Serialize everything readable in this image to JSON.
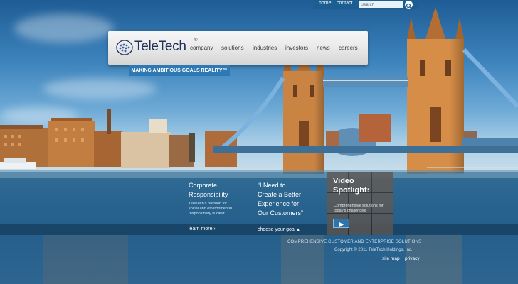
{
  "utility_nav": {
    "home": "home",
    "contact": "contact",
    "search_value": "Search"
  },
  "brand": {
    "name": "TeleTech",
    "tm": "®",
    "tagline": "MAKING AMBITIOUS GOALS REALITY™"
  },
  "main_nav": [
    "company",
    "solutions",
    "industries",
    "investors",
    "news",
    "careers"
  ],
  "panels": {
    "corporate": {
      "title_line1": "Corporate",
      "title_line2": "Responsibility",
      "body_line1": "TeleTech's passion for",
      "body_line2": "social and environmental",
      "body_line3": "responsibility is clear.",
      "link": "learn more ›"
    },
    "quote": {
      "line1": "“I Need to",
      "line2": "Create a Better",
      "line3": "Experience for",
      "line4": "Our Customers”",
      "link": "choose your goal ▴"
    },
    "video": {
      "title_line1": "Video",
      "title_line2": "Spotlight:",
      "desc_line1": "Comprehensive solutions for",
      "desc_line2": "today's challenges"
    }
  },
  "footer": {
    "tagline": "COMPREHENSIVE CUSTOMER AND ENTERPRISE SOLUTIONS",
    "copyright": "Copyright © 2011 TeleTech Holdings, Inc.",
    "site_map": "site map",
    "privacy": "privacy"
  }
}
